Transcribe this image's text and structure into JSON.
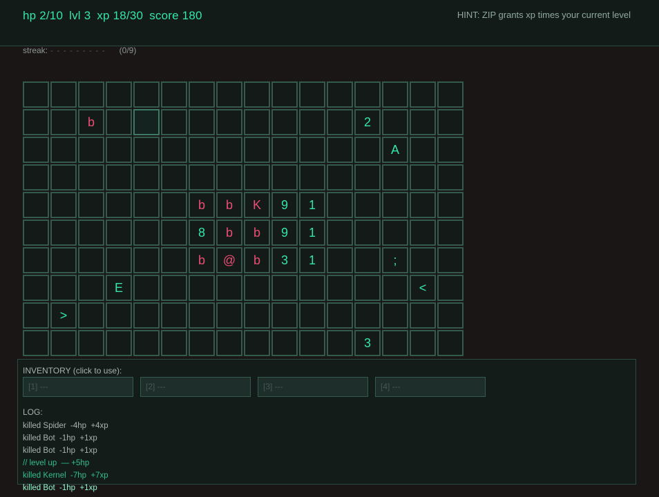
{
  "status": {
    "hp": "hp 2/10",
    "lvl": "lvl 3",
    "xp": "xp 18/30",
    "score": "score 180"
  },
  "hint": "HINT: ZIP grants xp times your current level",
  "streak": {
    "label": "streak:",
    "dashes": "- - - - - - - - -",
    "count": "(0/9)"
  },
  "board": {
    "cols": 16,
    "rows": 10,
    "selected": {
      "row": 1,
      "col": 4
    },
    "cells": [
      {
        "row": 1,
        "col": 2,
        "glyph": "b",
        "kind": "enemy"
      },
      {
        "row": 1,
        "col": 12,
        "glyph": "2",
        "kind": "item"
      },
      {
        "row": 2,
        "col": 13,
        "glyph": "A",
        "kind": "item"
      },
      {
        "row": 4,
        "col": 6,
        "glyph": "b",
        "kind": "enemy"
      },
      {
        "row": 4,
        "col": 7,
        "glyph": "b",
        "kind": "enemy"
      },
      {
        "row": 4,
        "col": 8,
        "glyph": "K",
        "kind": "enemy"
      },
      {
        "row": 4,
        "col": 9,
        "glyph": "9",
        "kind": "item"
      },
      {
        "row": 4,
        "col": 10,
        "glyph": "1",
        "kind": "item"
      },
      {
        "row": 5,
        "col": 6,
        "glyph": "8",
        "kind": "item"
      },
      {
        "row": 5,
        "col": 7,
        "glyph": "b",
        "kind": "enemy"
      },
      {
        "row": 5,
        "col": 8,
        "glyph": "b",
        "kind": "enemy"
      },
      {
        "row": 5,
        "col": 9,
        "glyph": "9",
        "kind": "item"
      },
      {
        "row": 5,
        "col": 10,
        "glyph": "1",
        "kind": "item"
      },
      {
        "row": 6,
        "col": 6,
        "glyph": "b",
        "kind": "enemy"
      },
      {
        "row": 6,
        "col": 7,
        "glyph": "@",
        "kind": "enemy"
      },
      {
        "row": 6,
        "col": 8,
        "glyph": "b",
        "kind": "enemy"
      },
      {
        "row": 6,
        "col": 9,
        "glyph": "3",
        "kind": "item"
      },
      {
        "row": 6,
        "col": 10,
        "glyph": "1",
        "kind": "item"
      },
      {
        "row": 6,
        "col": 13,
        "glyph": ";",
        "kind": "item"
      },
      {
        "row": 7,
        "col": 3,
        "glyph": "E",
        "kind": "item"
      },
      {
        "row": 7,
        "col": 14,
        "glyph": "<",
        "kind": "item"
      },
      {
        "row": 8,
        "col": 1,
        "glyph": ">",
        "kind": "item"
      },
      {
        "row": 9,
        "col": 12,
        "glyph": "3",
        "kind": "item"
      }
    ]
  },
  "inventory": {
    "label": "INVENTORY (click to use):",
    "slots": [
      "[1] ---",
      "[2] ---",
      "[3] ---",
      "[4] ---"
    ]
  },
  "log": {
    "label": "LOG:",
    "entries": [
      {
        "text": "killed Spider  -4hp  +4xp",
        "style": "normal"
      },
      {
        "text": "killed Bot  -1hp  +1xp",
        "style": "normal"
      },
      {
        "text": "killed Bot  -1hp  +1xp",
        "style": "normal"
      },
      {
        "text": "// level up  — +5hp",
        "style": "levelup"
      },
      {
        "text": "killed Kernel  -7hp  +7xp",
        "style": "kernel"
      },
      {
        "text": "killed Bot  -1hp  +1xp",
        "style": "latest"
      }
    ]
  },
  "colors": {
    "accent": "#35e6a8",
    "enemy": "#ec4d75",
    "cell_border": "#325a4d",
    "background": "#1a1616"
  }
}
